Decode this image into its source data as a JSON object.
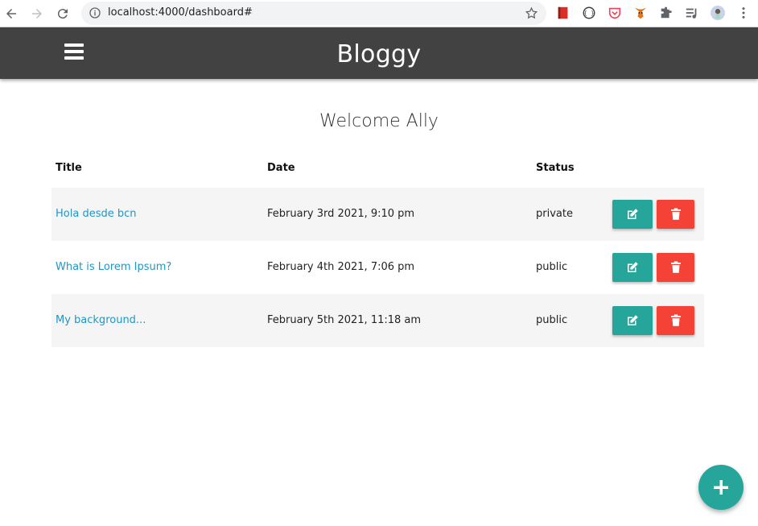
{
  "browser": {
    "url": "localhost:4000/dashboard#",
    "icons": [
      "back-icon",
      "forward-icon",
      "reload-icon",
      "info-icon",
      "bookmark-star-icon",
      "extensions-icon",
      "profile-avatar",
      "menu-kebab-icon"
    ]
  },
  "header": {
    "brand": "Bloggy",
    "color": "#424242"
  },
  "main": {
    "welcome": "Welcome Ally",
    "columns": [
      "Title",
      "Date",
      "Status"
    ],
    "rows": [
      {
        "title": "Hola desde bcn",
        "date": "February 3rd 2021, 9:10 pm",
        "status": "private"
      },
      {
        "title": "What is Lorem Ipsum?",
        "date": "February 4th 2021, 7:06 pm",
        "status": "public"
      },
      {
        "title": "My background...",
        "date": "February 5th 2021, 11:18 am",
        "status": "public"
      }
    ]
  },
  "colors": {
    "accent": "#26a69a",
    "danger": "#f44336",
    "link": "#2196c4"
  }
}
